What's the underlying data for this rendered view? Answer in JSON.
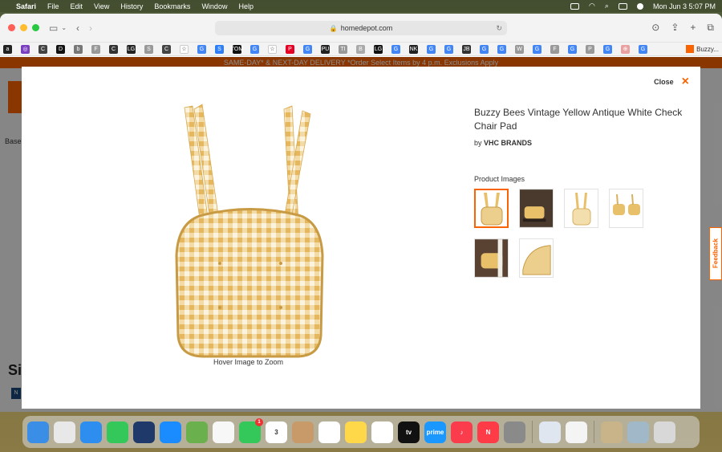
{
  "menubar": {
    "app": "Safari",
    "items": [
      "File",
      "Edit",
      "View",
      "History",
      "Bookmarks",
      "Window",
      "Help"
    ],
    "clock": "Mon Jun 3  5:07 PM"
  },
  "browser": {
    "url": "homedepot.com",
    "favorites": [
      "a",
      "◎",
      "C",
      "D",
      "b",
      "F",
      "C",
      "LG",
      "S",
      "C",
      "☆",
      "G",
      "S",
      "TOM",
      "G",
      "☆",
      "P",
      "G",
      "PU",
      "TI",
      "B",
      "LG",
      "G",
      "NK",
      "G",
      "G",
      "JB",
      "G",
      "G",
      "W",
      "G",
      "F",
      "G",
      "P",
      "G",
      "⊕",
      "G"
    ],
    "last_favorite": "Buzzy..."
  },
  "page": {
    "promo": "SAME-DAY* & NEXT-DAY DELIVERY *Order Select Items by 4 p.m. Exclusions Apply",
    "breadcrumb": "Base",
    "section_heading": "Si",
    "feedback_label": "Feedback"
  },
  "modal": {
    "close_label": "Close",
    "close_icon": "×",
    "title": "Buzzy Bees Vintage Yellow Antique White Check Chair Pad",
    "brand_prefix": "by",
    "brand": "VHC BRANDS",
    "product_images_label": "Product Images",
    "zoom_hint": "Hover Image to Zoom",
    "thumbnails": [
      {
        "name": "thumb-front",
        "active": true
      },
      {
        "name": "thumb-on-chair",
        "active": false
      },
      {
        "name": "thumb-ties",
        "active": false
      },
      {
        "name": "thumb-pair",
        "active": false
      },
      {
        "name": "thumb-chair-closeup",
        "active": false
      },
      {
        "name": "thumb-fabric-detail",
        "active": false
      }
    ]
  },
  "colors": {
    "accent": "#f96302",
    "gingham_yellow": "#e9c06a",
    "gingham_cream": "#fbf3dd"
  },
  "dock": {
    "apps": [
      {
        "name": "Finder",
        "color": "#3a8ee6",
        "label": ""
      },
      {
        "name": "Launchpad",
        "color": "#e8e8e8",
        "label": ""
      },
      {
        "name": "Safari",
        "color": "#2d8ef0",
        "label": ""
      },
      {
        "name": "Messages",
        "color": "#34c759",
        "label": ""
      },
      {
        "name": "App",
        "color": "#1f3a6a",
        "label": ""
      },
      {
        "name": "App Store",
        "color": "#1a8cff",
        "label": ""
      },
      {
        "name": "Maps",
        "color": "#6ab04c",
        "label": ""
      },
      {
        "name": "Photos",
        "color": "#f7f7f7",
        "label": ""
      },
      {
        "name": "FaceTime",
        "color": "#34c759",
        "label": "",
        "badge": "1"
      },
      {
        "name": "Calendar",
        "color": "#ffffff",
        "label": "3"
      },
      {
        "name": "Contacts",
        "color": "#c89a6a",
        "label": ""
      },
      {
        "name": "Reminders",
        "color": "#ffffff",
        "label": ""
      },
      {
        "name": "Notes",
        "color": "#ffd84a",
        "label": ""
      },
      {
        "name": "Freeform",
        "color": "#ffffff",
        "label": ""
      },
      {
        "name": "TV",
        "color": "#111111",
        "label": "tv"
      },
      {
        "name": "Prime Video",
        "color": "#1a98ff",
        "label": "prime"
      },
      {
        "name": "Music",
        "color": "#fa3c4c",
        "label": "♪"
      },
      {
        "name": "News",
        "color": "#ff3b48",
        "label": "N"
      },
      {
        "name": "System Settings",
        "color": "#8a8a8a",
        "label": ""
      },
      {
        "name": "Preview",
        "color": "#dfe6f0",
        "label": ""
      },
      {
        "name": "TextEdit",
        "color": "#f4f4f4",
        "label": ""
      },
      {
        "name": "Folder",
        "color": "#c9b48a",
        "label": ""
      },
      {
        "name": "Downloads",
        "color": "#a0b8c8",
        "label": ""
      },
      {
        "name": "Trash",
        "color": "#d8d8d8",
        "label": ""
      }
    ]
  }
}
